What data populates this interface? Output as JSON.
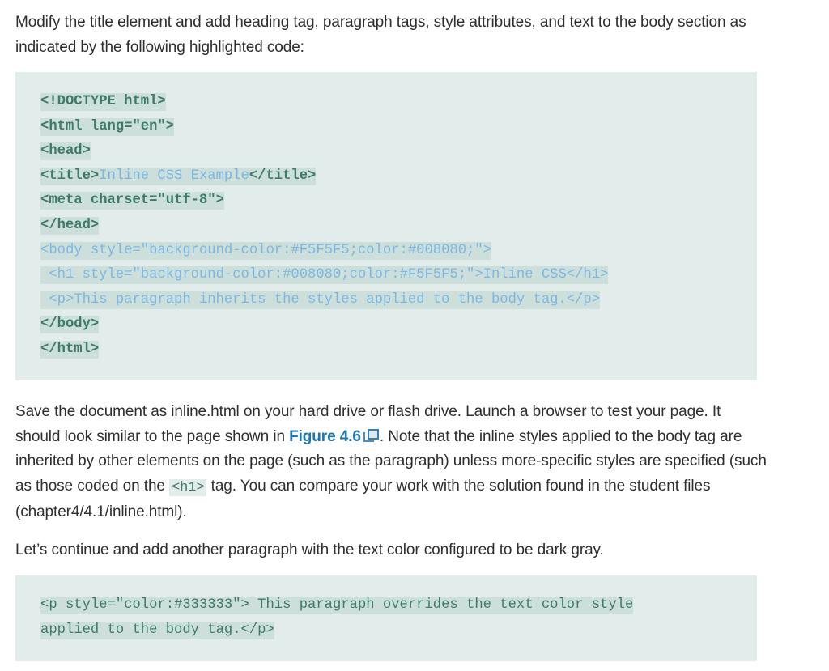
{
  "intro": {
    "text": "Modify the title element and add heading tag, paragraph tags, style attributes, and text to the body section as indicated by the following highlighted code:"
  },
  "code_block_1": {
    "lines": [
      {
        "pre": "<!DOCTYPE html>",
        "highlight": "",
        "post": "",
        "added": false
      },
      {
        "pre": "<html lang=\"en\">",
        "highlight": "",
        "post": "",
        "added": false
      },
      {
        "pre": "<head>",
        "highlight": "",
        "post": "",
        "added": false
      },
      {
        "pre": "<title>",
        "highlight": "Inline CSS Example",
        "post": "</title>",
        "added": false
      },
      {
        "pre": "<meta charset=\"utf-8\">",
        "highlight": "",
        "post": "",
        "added": false
      },
      {
        "pre": "</head>",
        "highlight": "",
        "post": "",
        "added": false
      },
      {
        "pre": "<body style=\"background-color:#F5F5F5;color:#008080;\">",
        "highlight": "",
        "post": "",
        "added": true
      },
      {
        "pre": " <h1 style=\"background-color:#008080;color:#F5F5F5;\">Inline CSS</h1>",
        "highlight": "",
        "post": "",
        "added": true
      },
      {
        "pre": " <p>This paragraph inherits the styles applied to the body tag.</p>",
        "highlight": "",
        "post": "",
        "added": true
      },
      {
        "pre": "</body>",
        "highlight": "",
        "post": "",
        "added": false
      },
      {
        "pre": "</html>",
        "highlight": "",
        "post": "",
        "added": false
      }
    ]
  },
  "save_paragraph": {
    "part1": "Save the document as inline.html on your hard drive or flash drive. Launch a browser to test your page. It should look similar to the page shown in ",
    "figure_link": "Figure 4.6",
    "part2": ". Note that the inline styles applied to the body tag are inherited by other elements on the page (such as the paragraph) unless more-specific styles are specified (such as those coded on the ",
    "inline_code": "<h1>",
    "part3": " tag. You can compare your work with the solution found in the student files (chapter4/4.1/inline.html)."
  },
  "continue_paragraph": {
    "text": "Let’s continue and add another paragraph with the text color configured to be dark gray."
  },
  "code_block_2": {
    "lines": [
      "<p style=\"color:#333333\"> This paragraph overrides the text color style",
      "applied to the body tag.</p>"
    ]
  },
  "colors": {
    "link": "#1a78b4",
    "code_bg": "#e2ecea",
    "code_line_bg": "#cddfdb",
    "code_text": "#3d7a68",
    "code_highlight_text": "#7bb7e3"
  }
}
